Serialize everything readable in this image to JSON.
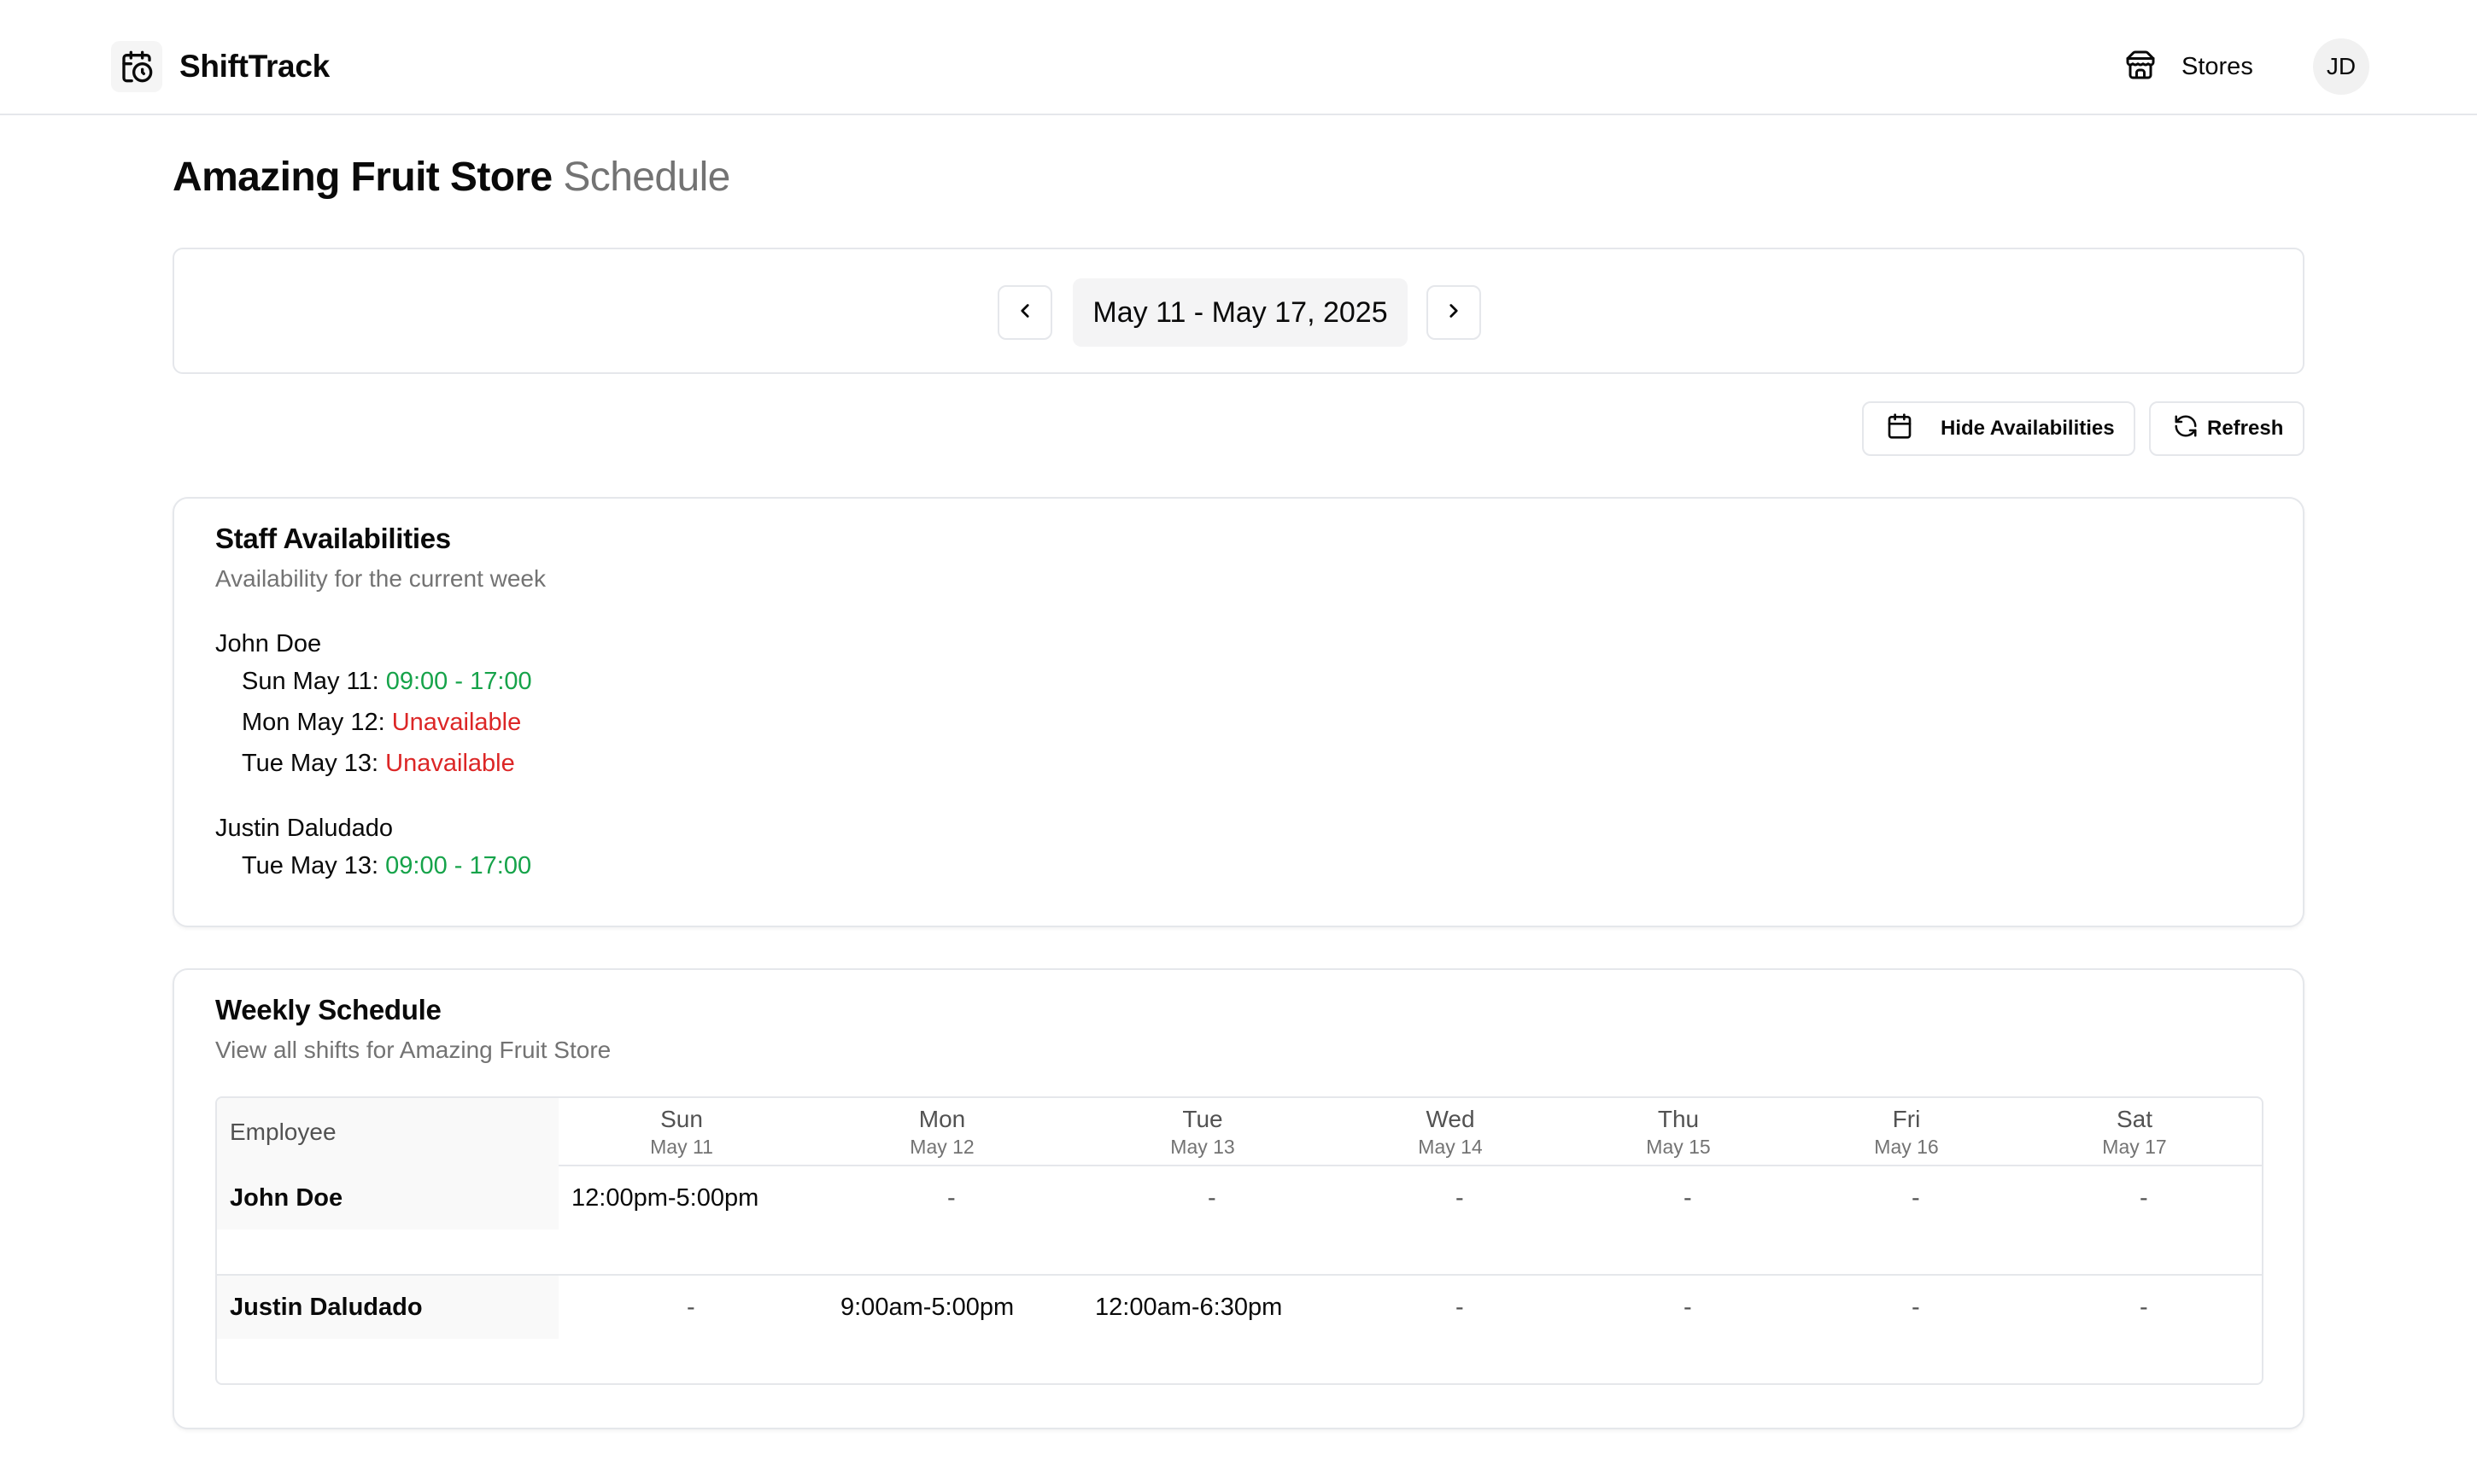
{
  "app": {
    "name": "ShiftTrack",
    "nav_stores": "Stores",
    "avatar_initials": "JD"
  },
  "page": {
    "title_main": "Amazing Fruit Store",
    "title_muted": "Schedule"
  },
  "week": {
    "label": "May 11 - May 17, 2025"
  },
  "actions": {
    "hide_availabilities": "Hide Availabilities",
    "refresh": "Refresh"
  },
  "availabilities": {
    "title": "Staff Availabilities",
    "subtitle": "Availability for the current week",
    "employees": [
      {
        "name": "John Doe",
        "entries": [
          {
            "day": "Sun May 11:",
            "value": "09:00 - 17:00",
            "status": "available"
          },
          {
            "day": "Mon May 12:",
            "value": "Unavailable",
            "status": "unavailable"
          },
          {
            "day": "Tue May 13:",
            "value": "Unavailable",
            "status": "unavailable"
          }
        ]
      },
      {
        "name": "Justin Daludado",
        "entries": [
          {
            "day": "Tue May 13:",
            "value": "09:00 - 17:00",
            "status": "available"
          }
        ]
      }
    ]
  },
  "schedule": {
    "title": "Weekly Schedule",
    "subtitle": "View all shifts for Amazing Fruit Store",
    "employee_header": "Employee",
    "days": [
      {
        "dow": "Sun",
        "date": "May 11"
      },
      {
        "dow": "Mon",
        "date": "May 12"
      },
      {
        "dow": "Tue",
        "date": "May 13"
      },
      {
        "dow": "Wed",
        "date": "May 14"
      },
      {
        "dow": "Thu",
        "date": "May 15"
      },
      {
        "dow": "Fri",
        "date": "May 16"
      },
      {
        "dow": "Sat",
        "date": "May 17"
      }
    ],
    "rows": [
      {
        "employee": "John Doe",
        "shifts": [
          "12:00pm-5:00pm",
          "-",
          "-",
          "-",
          "-",
          "-",
          "-"
        ]
      },
      {
        "employee": "Justin Daludado",
        "shifts": [
          "-",
          "9:00am-5:00pm",
          "12:00am-6:30pm",
          "-",
          "-",
          "-",
          "-"
        ]
      }
    ]
  },
  "colors": {
    "available": "#16a34a",
    "unavailable": "#dc2626",
    "border": "#e5e7eb",
    "muted_text": "#737373"
  },
  "icons": {
    "brand": "calendar-clock-icon",
    "stores": "store-icon",
    "prev": "chevron-left-icon",
    "next": "chevron-right-icon",
    "hide": "calendar-icon",
    "refresh": "refresh-icon"
  }
}
